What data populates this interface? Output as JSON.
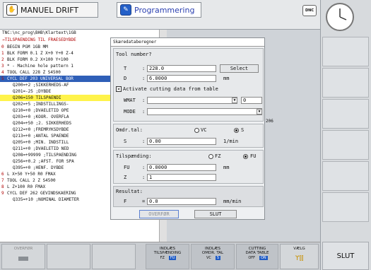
{
  "header": {
    "mode_left": "MANUEL DRIFT",
    "mode_right": "Programmering",
    "dnc": "DNC"
  },
  "program": {
    "path": "TNC:\\nc_prog\\BHB\\Klartext\\1GB",
    "subtitle": "→TILSPAENDING TIL FRAESEDYBDE",
    "lines": [
      {
        "n": "0",
        "t": "BEGIN PGM 1GB MM"
      },
      {
        "n": "1",
        "t": "BLK FORM 0.1 Z X+0 Y+0 Z-4"
      },
      {
        "n": "2",
        "t": "BLK FORM 0.2 X+100 Y+100"
      },
      {
        "n": "3",
        "t": "* - Machine hole pattern 1"
      },
      {
        "n": "4",
        "t": "TOOL CALL 228 Z S4500"
      },
      {
        "n": "5",
        "t": "CYCL DEF 203 UNIVERSAL BOR"
      },
      {
        "n": "",
        "t": "Q200=+2    ;SIKKERHEDS-AF"
      },
      {
        "n": "",
        "t": "Q201=-25   ;DYBDE"
      },
      {
        "n": "",
        "t": "Q206=150   TILSPAENDI"
      },
      {
        "n": "",
        "t": "Q202=+5    ;INDSTILLINGS-"
      },
      {
        "n": "",
        "t": "Q210=+0    ;DVAELETID OPE"
      },
      {
        "n": "",
        "t": "Q203=+0    ;KOOR. OVERFLA"
      },
      {
        "n": "",
        "t": "Q204=+50   ;2. SIKKERHEDS"
      },
      {
        "n": "",
        "t": "Q212=+0    ;FREMRYKSDYBDE"
      },
      {
        "n": "",
        "t": "Q213=+0    ;ANTAL SPAENDE"
      },
      {
        "n": "",
        "t": "Q205=+0    ;MIN. INDSTILL"
      },
      {
        "n": "",
        "t": "Q211=+0    ;DVAELETID NED"
      },
      {
        "n": "",
        "t": "Q208=+99999 ;TILSPAENDING"
      },
      {
        "n": "",
        "t": "Q256=+0.2  ;AFST. FOR SPA"
      },
      {
        "n": "",
        "t": "Q395=+0    ;HENF. DYBDE"
      },
      {
        "n": "6",
        "t": "L  X+50  Y+50 R0 FMAX"
      },
      {
        "n": "7",
        "t": "TOOL CALL 2 Z S4500"
      },
      {
        "n": "8",
        "t": "L  Z+100 R0 FMAX"
      },
      {
        "n": "9",
        "t": "CYCL DEF 262 GEVINDSKAERING"
      },
      {
        "n": "",
        "t": "Q335=+10   ;NOMINAL DIAMETER"
      }
    ],
    "side_value": "206"
  },
  "dialog": {
    "title": "Skæredataberegner",
    "tool_label": "Tool number?",
    "t_label": "T",
    "t_value": "228.0",
    "select_label": "Select",
    "d_label": "D",
    "d_value": "6.0000",
    "d_unit": "mm",
    "activate_label": "Activate cutting data from table",
    "wmat_label": "WMAT",
    "wmat_value": "",
    "wmat_num": "0",
    "mode_label": "MODE",
    "mode_value": "",
    "omdr_label": "Omdr.tal:",
    "vc_label": "VC",
    "s_label": "S",
    "s_radio": "S",
    "s_value": "0.00",
    "s_unit": "1/min",
    "tilsp_label": "Tilspænding:",
    "fz_label": "FZ",
    "fu_label": "FU",
    "fu_value": "0.0000",
    "fu_unit": "mm",
    "z_label": "Z",
    "z_value": "1",
    "result_label": "Resultat:",
    "f_label": "F",
    "f_value": "0.0",
    "f_unit": "mm/min",
    "overfor_label": "OVERFØR",
    "slut_label": "SLUT"
  },
  "softkeys": {
    "overfor": "OVERFØR",
    "k1_line1": "INDLÆS",
    "k1_line2": "TILSPÆNDING",
    "k1_a": "FZ",
    "k1_b": "FU",
    "k2_line1": "INDLÆS",
    "k2_line2": "OMDR. TAL",
    "k2_a": "VC",
    "k2_b": "S",
    "k3_line1": "CUTTING",
    "k3_line2": "DATA TABLE",
    "k3_a": "OFF",
    "k3_b": "ON",
    "k4": "VÆLG",
    "slut": "SLUT"
  }
}
